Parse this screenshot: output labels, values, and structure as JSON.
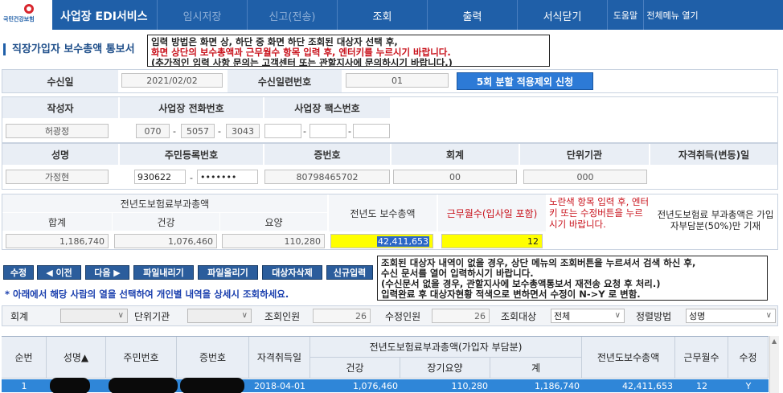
{
  "header": {
    "logo_text": "국민건강보험",
    "app_title": "사업장 EDI서비스",
    "nav": [
      {
        "label": "임시저장",
        "enabled": false
      },
      {
        "label": "신고(전송)",
        "enabled": false
      },
      {
        "label": "조회",
        "enabled": true
      },
      {
        "label": "출력",
        "enabled": true
      },
      {
        "label": "서식닫기",
        "enabled": true
      },
      {
        "label": "도움말",
        "enabled": true
      },
      {
        "label": "전체메뉴 열기",
        "enabled": true
      }
    ]
  },
  "page": {
    "title": "직장가입자 보수총액 통보서",
    "notice_top": {
      "line1": "입력 방법은 화면 상, 하단 중 화면 하단 조회된 대상자 선택 후,",
      "line2": "화면 상단의 보수총액과 근무월수 항목 입력 후, 엔터키를 누르시기 바랍니다.",
      "line3": "(추가적인 입력 사항 문의는 고객센터 또는 관할지사에 문의하시기 바랍니다.)"
    }
  },
  "form": {
    "received_date_label": "수신일",
    "received_date": "2021/02/02",
    "received_serial_label": "수신일련번호",
    "received_serial": "01",
    "installment_button": "5회 분할 적용제외 신청",
    "writer_label": "작성자",
    "writer": "허광정",
    "phone_label": "사업장 전화번호",
    "phone": [
      "070",
      "5057",
      "3043"
    ],
    "fax_label": "사업장 팩스번호",
    "name_label": "성명",
    "name": "가정현",
    "rrn_label": "주민등록번호",
    "rrn_front": "930622",
    "rrn_back": "•••••••",
    "card_label": "증번호",
    "card_no": "80798465702",
    "account_label": "회계",
    "account": "00",
    "unit_label": "단위기관",
    "unit": "000",
    "qualification_label": "자격취득(변동)일",
    "premium_group_label": "전년도보험료부과총액",
    "sum_label": "합계",
    "sum": "1,186,740",
    "health_label": "건강",
    "health": "1,076,460",
    "care_label": "요양",
    "care": "110,280",
    "total_pay_label": "전년도 보수총액",
    "total_pay": "42,411,653",
    "months_label": "근무월수(입사일 포함)",
    "months": "12",
    "yellow_note": "노란색 항목 입력 후, 엔터키 또는 수정버튼을 누르시기 바랍니다.",
    "premium_note": "전년도보험료 부과총액은 가입자부담분(50%)만 기재"
  },
  "toolbar": {
    "buttons": [
      "수정",
      "◀ 이전",
      "다음 ▶",
      "파일내리기",
      "파일올리기",
      "대상자삭제",
      "신규입력"
    ],
    "notice": {
      "line1": "조회된 대상자 내역이 없을 경우, 상단 메뉴의 조회버튼을 누르셔서 검색 하신 후,",
      "line2": "수신 문서를 열어 입력하시기 바랍니다.",
      "line3": "(수신문서 없을 경우, 관할지사에 보수총액통보서 재전송 요청 후 처리.)",
      "line4": "입력완료 후 대상자현황 적색으로 변하면서 수정이 N->Y 로 변함."
    },
    "hint": "* 아래에서 해당 사람의 열을 선택하여 개인별 내역을 상세시 조회하세요."
  },
  "filter": {
    "account_label": "회계",
    "unit_label": "단위기관",
    "query_count_label": "조회인원",
    "query_count": "26",
    "modified_count_label": "수정인원",
    "modified_count": "26",
    "target_label": "조회대상",
    "target": "전체",
    "sort_label": "정렬방법",
    "sort": "성명"
  },
  "grid": {
    "headers": {
      "seq": "순번",
      "name": "성명▲",
      "rrn": "주민번호",
      "card": "증번호",
      "qual_date": "자격취득일",
      "premium_group": "전년도보험료부과총액(가입자 부담분)",
      "health": "건강",
      "care": "장기요양",
      "total": "계",
      "pay": "전년도보수총액",
      "months": "근무월수",
      "modified": "수정"
    },
    "rows": [
      {
        "seq": "1",
        "qual_date": "2018-04-01",
        "health": "1,076,460",
        "care": "110,280",
        "total": "1,186,740",
        "pay": "42,411,653",
        "months": "12",
        "modified": "Y"
      }
    ]
  },
  "colors": {
    "brand": "#1f5fa8",
    "highlight": "#ffff00",
    "selected_row": "#2f86d8",
    "notice_red": "#c8101a"
  }
}
